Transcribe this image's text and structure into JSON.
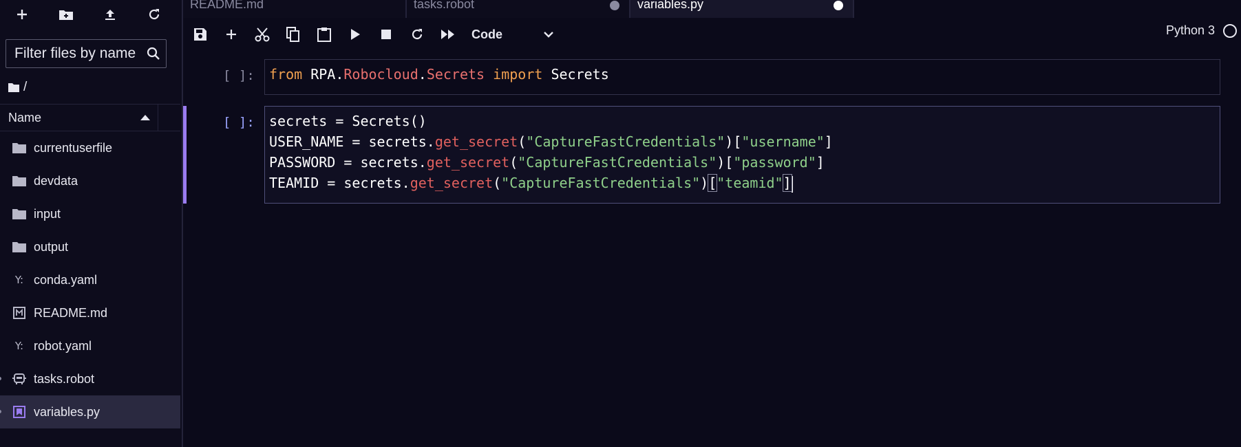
{
  "sidebar": {
    "search_placeholder": "Filter files by name",
    "breadcrumb": "/",
    "column_name": "Name",
    "files": [
      {
        "name": "currentuserfile",
        "icon": "folder-icon"
      },
      {
        "name": "devdata",
        "icon": "folder-icon"
      },
      {
        "name": "input",
        "icon": "folder-icon"
      },
      {
        "name": "output",
        "icon": "folder-icon"
      },
      {
        "name": "conda.yaml",
        "icon": "yaml-icon"
      },
      {
        "name": "README.md",
        "icon": "markdown-icon"
      },
      {
        "name": "robot.yaml",
        "icon": "yaml-icon"
      },
      {
        "name": "tasks.robot",
        "icon": "robot-icon"
      },
      {
        "name": "variables.py",
        "icon": "python-file-icon"
      }
    ],
    "yaml_glyph": "Y:"
  },
  "tabs": [
    {
      "label": "README.md"
    },
    {
      "label": "tasks.robot"
    },
    {
      "label": "variables.py"
    }
  ],
  "toolbar": {
    "cell_type": "Code",
    "kernel": "Python 3"
  },
  "cells": [
    {
      "prompt": "[ ]:",
      "code": "from RPA.Robocloud.Secrets import Secrets"
    },
    {
      "prompt": "[ ]:",
      "code": "secrets = Secrets()\nUSER_NAME = secrets.get_secret(\"CaptureFastCredentials\")[\"username\"]\nPASSWORD = secrets.get_secret(\"CaptureFastCredentials\")[\"password\"]\nTEAMID = secrets.get_secret(\"CaptureFastCredentials\")[\"teamid\"]"
    }
  ],
  "colors": {
    "background": "#0b0a1a",
    "accent": "#9a7cf0",
    "keyword": "#f0a050",
    "string": "#8fd08a",
    "function": "#e0605e"
  }
}
